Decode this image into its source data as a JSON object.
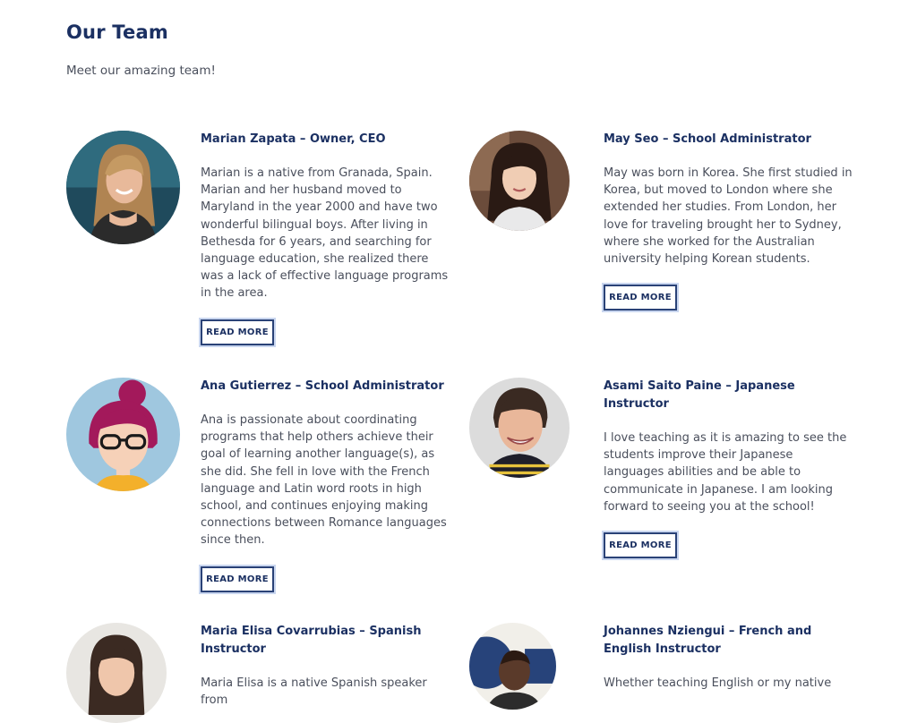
{
  "page": {
    "title": "Our Team",
    "intro": "Meet our amazing team!"
  },
  "members": [
    {
      "name": "Marian Zapata – Owner, CEO",
      "bio": "Marian is a native from Granada, Spain. Marian and her husband moved to Maryland in the year 2000 and have two wonderful bilingual boys. After living in Bethesda for 6 years, and searching for language education, she realized there was a lack of effective language programs in the area.",
      "button": "READ MORE",
      "photo_icon": "woman-portrait-photo"
    },
    {
      "name": "May Seo – School Administrator",
      "bio": "May was born in Korea. She first studied in Korea, but moved to London where she extended her studies. From London, her love for traveling brought her to Sydney, where she worked for the Australian university helping Korean students.",
      "button": "READ MORE",
      "photo_icon": "woman-portrait-photo"
    },
    {
      "name": "Ana Gutierrez – School Administrator",
      "bio": "Ana is passionate about coordinating programs that help others achieve their goal of learning another language(s), as she did. She fell in love with the French language and Latin word roots in high school, and continues enjoying making connections between Romance languages since then.",
      "button": "READ MORE",
      "photo_icon": "cartoon-avatar-woman-glasses"
    },
    {
      "name": "Asami Saito Paine – Japanese Instructor",
      "bio": "I love teaching as it is amazing to see the students improve their Japanese languages abilities and be able to communicate in Japanese. I am looking forward to seeing you at the school!",
      "button": "READ MORE",
      "photo_icon": "woman-portrait-photo"
    },
    {
      "name": "Maria Elisa Covarrubias – Spanish Instructor",
      "bio": "Maria Elisa is a native Spanish speaker from",
      "photo_icon": "woman-portrait-photo"
    },
    {
      "name": "Johannes Nziengui – French and English Instructor",
      "bio": "Whether teaching English or my native",
      "photo_icon": "man-portrait-photo"
    }
  ],
  "colors": {
    "heading": "#1b3062",
    "text": "#4a4f5c",
    "button_border": "#2a4277"
  }
}
